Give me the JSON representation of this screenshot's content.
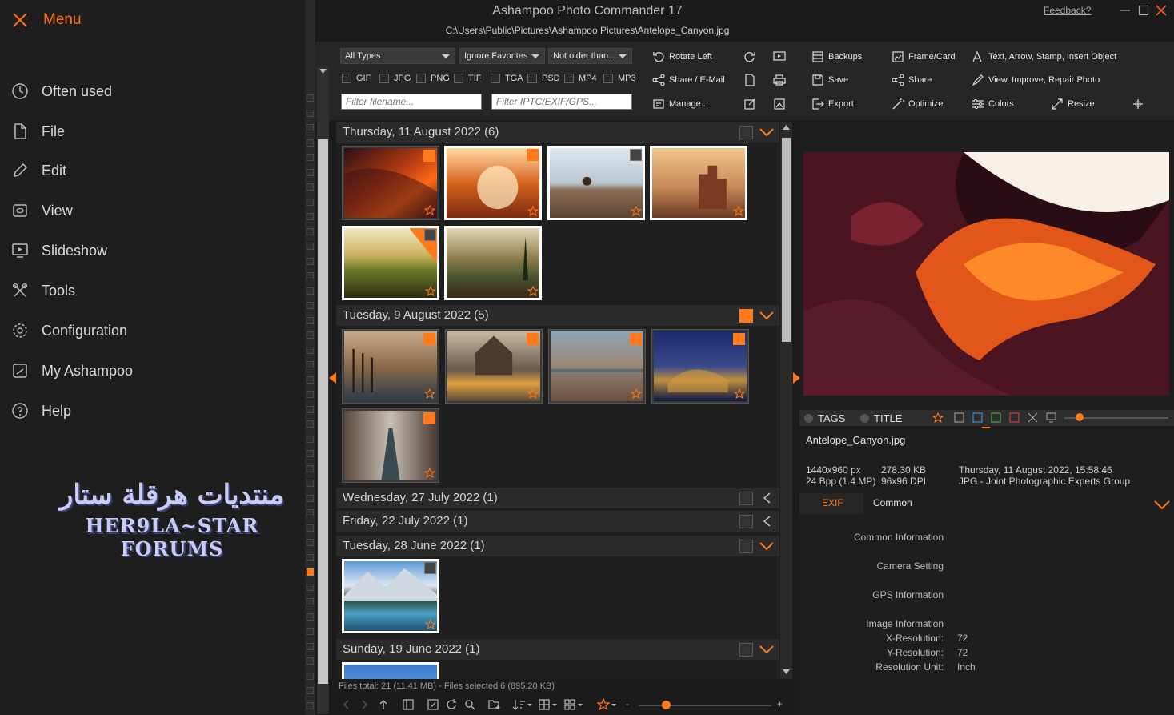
{
  "window": {
    "title": "Ashampoo Photo Commander 17",
    "path": "C:\\Users\\Public\\Pictures\\Ashampoo Pictures\\Antelope_Canyon.jpg",
    "feedback": "Feedback?"
  },
  "menu": {
    "title": "Menu",
    "items": [
      {
        "label": "Often used",
        "icon": "clock-icon"
      },
      {
        "label": "File",
        "icon": "file-icon"
      },
      {
        "label": "Edit",
        "icon": "pencil-icon"
      },
      {
        "label": "View",
        "icon": "view-icon"
      },
      {
        "label": "Slideshow",
        "icon": "slideshow-icon"
      },
      {
        "label": "Tools",
        "icon": "tools-icon"
      },
      {
        "label": "Configuration",
        "icon": "gear-icon"
      },
      {
        "label": "My Ashampoo",
        "icon": "ashampoo-icon"
      },
      {
        "label": "Help",
        "icon": "help-icon"
      }
    ],
    "watermark_line1": "منتديات هرقلة ستار",
    "watermark_line2": "HER9LA~STAR FORUMS"
  },
  "filters": {
    "type": "All Types",
    "favorites": "Ignore Favorites",
    "age": "Not older than...",
    "checkboxes": [
      "GIF",
      "JPG",
      "PNG",
      "TIF",
      "TGA",
      "PSD",
      "MP4",
      "MP3"
    ],
    "filename_placeholder": "Filter filename...",
    "meta_placeholder": "Filter IPTC/EXIF/GPS..."
  },
  "toolbar": {
    "rotate_left": "Rotate Left",
    "share_email": "Share / E-Mail",
    "manage": "Manage...",
    "backups": "Backups",
    "save": "Save",
    "export": "Export",
    "frame_card": "Frame/Card",
    "share": "Share",
    "optimize": "Optimize",
    "colors": "Colors",
    "text_arrow": "Text, Arrow, Stamp, Insert Object",
    "view_improve": "View, Improve, Repair Photo",
    "resize": "Resize"
  },
  "groups": [
    {
      "label": "Thursday, 11 August 2022 (6)",
      "checked": false,
      "expanded": true
    },
    {
      "label": "Tuesday, 9 August 2022 (5)",
      "checked": true,
      "expanded": true
    },
    {
      "label": "Wednesday, 27 July 2022 (1)",
      "checked": false,
      "expanded": false
    },
    {
      "label": "Friday, 22 July 2022 (1)",
      "checked": false,
      "expanded": false
    },
    {
      "label": "Tuesday, 28 June 2022 (1)",
      "checked": false,
      "expanded": true
    },
    {
      "label": "Sunday, 19 June 2022 (1)",
      "checked": false,
      "expanded": true
    }
  ],
  "status": "Files total: 21 (11.41 MB) - Files selected 6 (895.20 KB)",
  "preview_tabs": {
    "tags": "TAGS",
    "title": "TITLE"
  },
  "file_info": {
    "name": "Antelope_Canyon.jpg",
    "dimensions": "1440x960 px",
    "bpp": "24 Bpp (1.4 MP)",
    "size": "278.30 KB",
    "dpi": "96x96 DPI",
    "date": "Thursday, 11 August 2022, 15:58:46",
    "format": "JPG - Joint Photographic Experts Group"
  },
  "exif": {
    "tab": "EXIF",
    "section": "Common",
    "common": "Common Information",
    "camera": "Camera Setting",
    "gps": "GPS Information",
    "image": "Image Information",
    "xres_label": "X-Resolution:",
    "xres": "72",
    "yres_label": "Y-Resolution:",
    "yres": "72",
    "unit_label": "Resolution Unit:",
    "unit": "Inch"
  },
  "colors": {
    "accent": "#ff7a1a"
  }
}
